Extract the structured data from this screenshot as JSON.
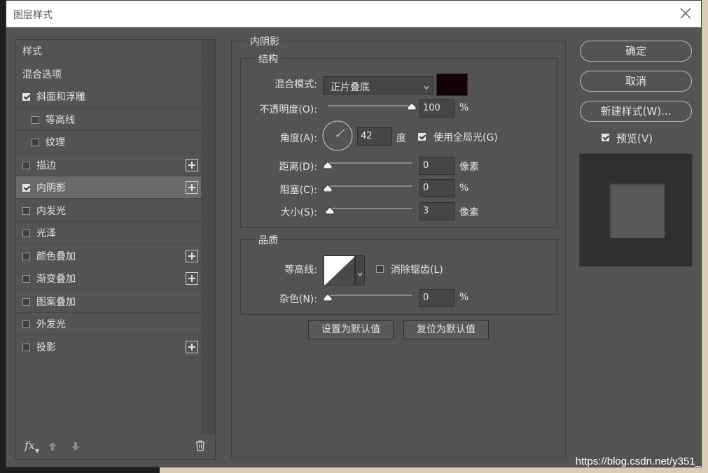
{
  "window": {
    "title": "图层样式"
  },
  "left_panel": {
    "items": [
      {
        "label": "样式",
        "checkbox": false,
        "checked": false,
        "plus": false,
        "selected": false
      },
      {
        "label": "混合选项",
        "checkbox": false,
        "checked": false,
        "plus": false,
        "selected": false
      },
      {
        "label": "斜面和浮雕",
        "checkbox": true,
        "checked": true,
        "plus": false,
        "selected": false
      },
      {
        "label": "等高线",
        "checkbox": true,
        "checked": false,
        "plus": false,
        "selected": false,
        "indent": true
      },
      {
        "label": "纹理",
        "checkbox": true,
        "checked": false,
        "plus": false,
        "selected": false,
        "indent": true
      },
      {
        "label": "描边",
        "checkbox": true,
        "checked": false,
        "plus": true,
        "selected": false
      },
      {
        "label": "内阴影",
        "checkbox": true,
        "checked": true,
        "plus": true,
        "selected": true
      },
      {
        "label": "内发光",
        "checkbox": true,
        "checked": false,
        "plus": false,
        "selected": false
      },
      {
        "label": "光泽",
        "checkbox": true,
        "checked": false,
        "plus": false,
        "selected": false
      },
      {
        "label": "颜色叠加",
        "checkbox": true,
        "checked": false,
        "plus": true,
        "selected": false
      },
      {
        "label": "渐变叠加",
        "checkbox": true,
        "checked": false,
        "plus": true,
        "selected": false
      },
      {
        "label": "图案叠加",
        "checkbox": true,
        "checked": false,
        "plus": false,
        "selected": false
      },
      {
        "label": "外发光",
        "checkbox": true,
        "checked": false,
        "plus": false,
        "selected": false
      },
      {
        "label": "投影",
        "checkbox": true,
        "checked": false,
        "plus": true,
        "selected": false
      }
    ],
    "footer": {
      "fx_label": "fx"
    }
  },
  "inner_shadow": {
    "section_title": "内阴影",
    "structure": {
      "title": "结构",
      "blend_mode_label": "混合模式:",
      "blend_mode_value": "正片叠底",
      "color": "#120006",
      "opacity_label": "不透明度(O):",
      "opacity_value": "100",
      "opacity_unit": "%",
      "opacity_level": 1.0,
      "angle_label": "角度(A):",
      "angle_value": "42",
      "angle_unit": "度",
      "global_light_label": "使用全局光(G)",
      "global_light_checked": true,
      "distance_label": "距离(D):",
      "distance_value": "0",
      "distance_unit": "像素",
      "choke_label": "阻塞(C):",
      "choke_value": "0",
      "choke_unit": "%",
      "size_label": "大小(S):",
      "size_value": "3",
      "size_unit": "像素"
    },
    "quality": {
      "title": "品质",
      "contour_label": "等高线:",
      "anti_alias_label": "消除锯齿(L)",
      "anti_alias_checked": false,
      "noise_label": "杂色(N):",
      "noise_value": "0",
      "noise_unit": "%"
    },
    "make_default": "设置为默认值",
    "reset_default": "复位为默认值"
  },
  "right_panel": {
    "ok": "确定",
    "cancel": "取消",
    "new_style": "新建样式(W)...",
    "preview_label": "预览(V)",
    "preview_checked": true
  },
  "watermark": "https://blog.csdn.net/y351_"
}
